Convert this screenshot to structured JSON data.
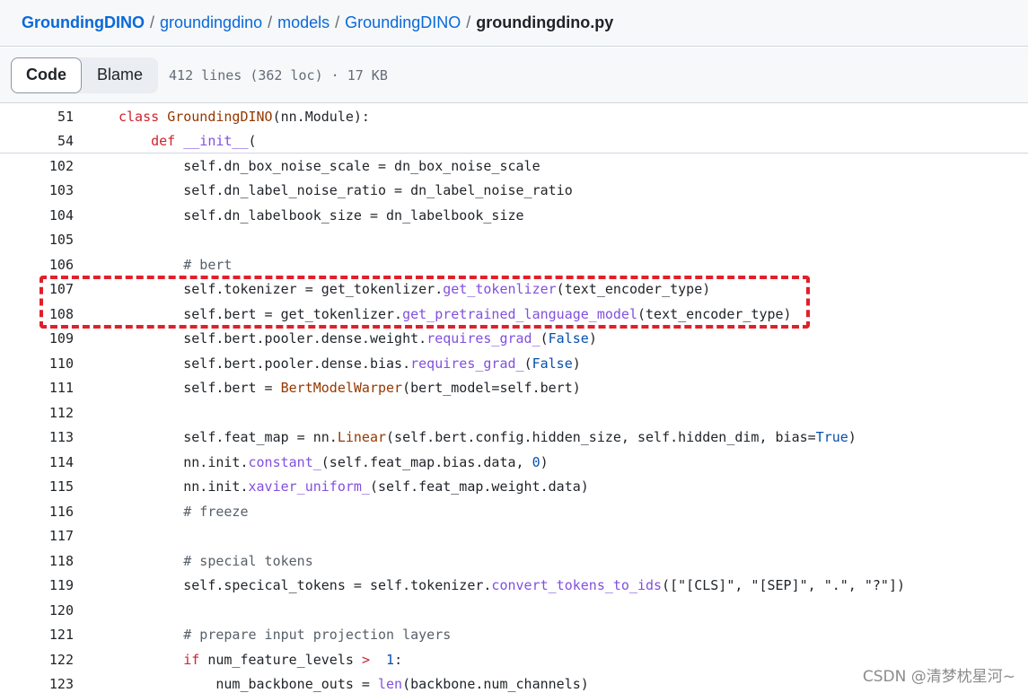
{
  "breadcrumb": {
    "repo": "GroundingDINO",
    "parts": [
      "groundingdino",
      "models",
      "GroundingDINO"
    ],
    "separator": "/",
    "current_file": "groundingdino.py"
  },
  "toolbar": {
    "code_label": "Code",
    "blame_label": "Blame",
    "file_info": "412 lines (362 loc) · 17 KB"
  },
  "sticky_lines": [
    {
      "num": "51",
      "indent": 0,
      "tokens": [
        [
          "kw",
          "class "
        ],
        [
          "cls",
          "GroundingDINO"
        ],
        [
          "",
          "(nn.Module):"
        ]
      ]
    },
    {
      "num": "54",
      "indent": 4,
      "tokens": [
        [
          "kw",
          "def "
        ],
        [
          "fn",
          "__init__"
        ],
        [
          "",
          "("
        ]
      ]
    }
  ],
  "code_lines": [
    {
      "num": "102",
      "indent": 8,
      "tokens": [
        [
          "",
          "self.dn_box_noise_scale = dn_box_noise_scale"
        ]
      ]
    },
    {
      "num": "103",
      "indent": 8,
      "tokens": [
        [
          "",
          "self.dn_label_noise_ratio = dn_label_noise_ratio"
        ]
      ]
    },
    {
      "num": "104",
      "indent": 8,
      "tokens": [
        [
          "",
          "self.dn_labelbook_size = dn_labelbook_size"
        ]
      ]
    },
    {
      "num": "105",
      "indent": 0,
      "tokens": []
    },
    {
      "num": "106",
      "indent": 8,
      "tokens": [
        [
          "cm",
          "# bert"
        ]
      ]
    },
    {
      "num": "107",
      "indent": 8,
      "tokens": [
        [
          "",
          "self.tokenizer = get_tokenlizer."
        ],
        [
          "fn",
          "get_tokenlizer"
        ],
        [
          "",
          "(text_encoder_type)"
        ]
      ]
    },
    {
      "num": "108",
      "indent": 8,
      "tokens": [
        [
          "",
          "self.bert = get_tokenlizer."
        ],
        [
          "fn",
          "get_pretrained_language_model"
        ],
        [
          "",
          "(text_encoder_type)"
        ]
      ]
    },
    {
      "num": "109",
      "indent": 8,
      "tokens": [
        [
          "",
          "self.bert.pooler.dense.weight."
        ],
        [
          "fn",
          "requires_grad_"
        ],
        [
          "",
          "("
        ],
        [
          "const",
          "False"
        ],
        [
          "",
          ")"
        ]
      ]
    },
    {
      "num": "110",
      "indent": 8,
      "tokens": [
        [
          "",
          "self.bert.pooler.dense.bias."
        ],
        [
          "fn",
          "requires_grad_"
        ],
        [
          "",
          "("
        ],
        [
          "const",
          "False"
        ],
        [
          "",
          ")"
        ]
      ]
    },
    {
      "num": "111",
      "indent": 8,
      "tokens": [
        [
          "",
          "self.bert = "
        ],
        [
          "cls",
          "BertModelWarper"
        ],
        [
          "",
          "(bert_model=self.bert)"
        ]
      ]
    },
    {
      "num": "112",
      "indent": 0,
      "tokens": []
    },
    {
      "num": "113",
      "indent": 8,
      "tokens": [
        [
          "",
          "self.feat_map = nn."
        ],
        [
          "cls",
          "Linear"
        ],
        [
          "",
          "(self.bert.config.hidden_size, self.hidden_dim, bias="
        ],
        [
          "const",
          "True"
        ],
        [
          "",
          ")"
        ]
      ]
    },
    {
      "num": "114",
      "indent": 8,
      "tokens": [
        [
          "",
          "nn.init."
        ],
        [
          "fn",
          "constant_"
        ],
        [
          "",
          "(self.feat_map.bias.data, "
        ],
        [
          "num",
          "0"
        ],
        [
          "",
          ")"
        ]
      ]
    },
    {
      "num": "115",
      "indent": 8,
      "tokens": [
        [
          "",
          "nn.init."
        ],
        [
          "fn",
          "xavier_uniform_"
        ],
        [
          "",
          "(self.feat_map.weight.data)"
        ]
      ]
    },
    {
      "num": "116",
      "indent": 8,
      "tokens": [
        [
          "cm",
          "# freeze"
        ]
      ]
    },
    {
      "num": "117",
      "indent": 0,
      "tokens": []
    },
    {
      "num": "118",
      "indent": 8,
      "tokens": [
        [
          "cm",
          "# special tokens"
        ]
      ]
    },
    {
      "num": "119",
      "indent": 8,
      "tokens": [
        [
          "",
          "self.specical_tokens = self.tokenizer."
        ],
        [
          "fn",
          "convert_tokens_to_ids"
        ],
        [
          "",
          "([\"[CLS]\", \"[SEP]\", \".\", \"?\"])"
        ]
      ]
    },
    {
      "num": "120",
      "indent": 0,
      "tokens": []
    },
    {
      "num": "121",
      "indent": 8,
      "tokens": [
        [
          "cm",
          "# prepare input projection layers"
        ]
      ]
    },
    {
      "num": "122",
      "indent": 8,
      "tokens": [
        [
          "kw",
          "if "
        ],
        [
          "",
          "num_feature_levels "
        ],
        [
          "kw",
          ">"
        ],
        [
          "",
          "  "
        ],
        [
          "num",
          "1"
        ],
        [
          "",
          ":"
        ]
      ]
    },
    {
      "num": "123",
      "indent": 12,
      "tokens": [
        [
          "",
          "num_backbone_outs = "
        ],
        [
          "fn",
          "len"
        ],
        [
          "",
          "(backbone.num_channels)"
        ]
      ]
    }
  ],
  "watermark": "CSDN @清梦枕星河~",
  "colors": {
    "link": "#0969da",
    "keyword": "#cf222e",
    "class": "#953800",
    "function": "#8250df",
    "comment": "#57606a",
    "constant": "#0550ae",
    "annotation_box": "#e0202a"
  }
}
